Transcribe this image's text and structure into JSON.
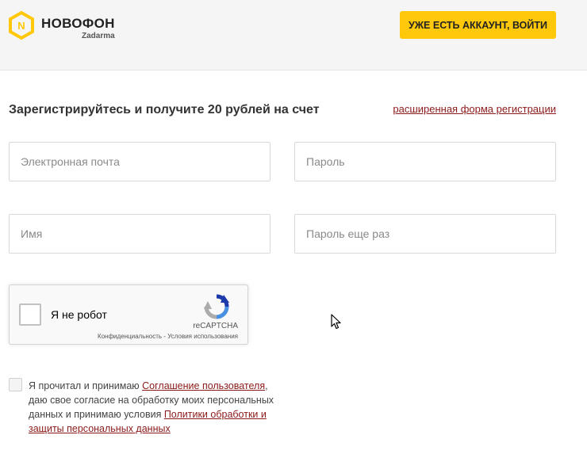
{
  "header": {
    "logo_name": "НОВОФОН",
    "logo_sub": "Zadarma",
    "login_button": "УЖЕ ЕСТЬ АККАУНТ, ВОЙТИ"
  },
  "form": {
    "title": "Зарегистрируйтесь и получите 20 рублей на счет",
    "extended_link": "расширенная форма регистрации",
    "email": {
      "placeholder": "Электронная почта",
      "value": ""
    },
    "password": {
      "placeholder": "Пароль",
      "value": ""
    },
    "name": {
      "placeholder": "Имя",
      "value": ""
    },
    "password_repeat": {
      "placeholder": "Пароль еще раз",
      "value": ""
    }
  },
  "recaptcha": {
    "label": "Я не робот",
    "brand": "reCAPTCHA",
    "terms": "Конфиденциальность - Условия использования"
  },
  "agreement": {
    "text_1": "Я прочитал и принимаю ",
    "link_1": "Соглашение пользователя",
    "text_2": ", даю свое согласие на обработку моих персональных данных и принимаю условия ",
    "link_2": "Политики обработки и защиты персональных данных",
    "checked": false
  },
  "colors": {
    "accent": "#ffc80a",
    "link": "#8b1a1a",
    "header_bg": "#f5f5f5"
  },
  "icons": [
    "novofon-logo-icon",
    "recaptcha-logo-icon",
    "mouse-cursor-icon"
  ]
}
